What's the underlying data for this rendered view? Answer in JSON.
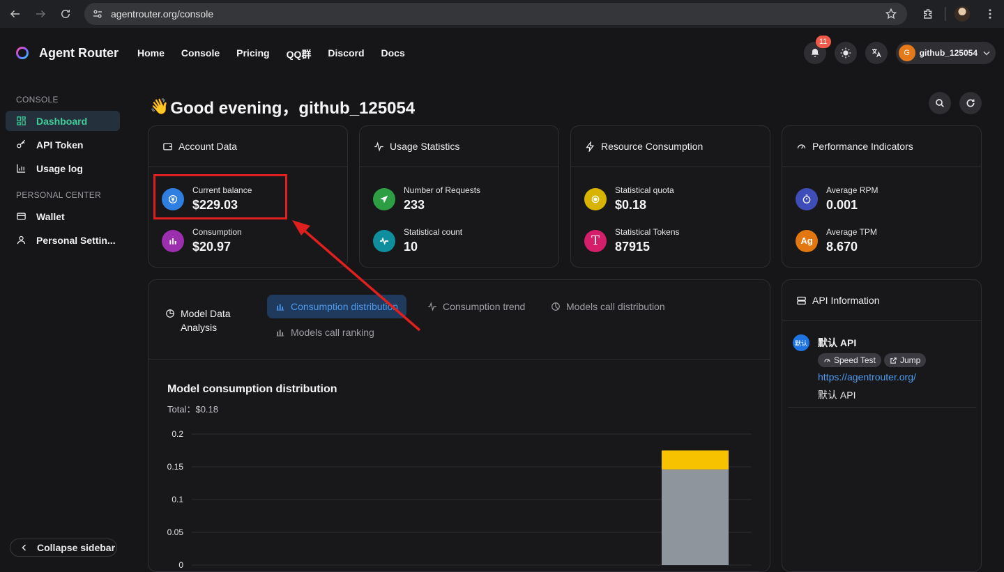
{
  "browser": {
    "url": "agentrouter.org/console"
  },
  "header": {
    "brand": "Agent Router",
    "nav": [
      "Home",
      "Console",
      "Pricing",
      "QQ群",
      "Discord",
      "Docs"
    ],
    "notifications_count": "11",
    "user_initial": "G",
    "username": "github_125054"
  },
  "sidebar": {
    "section_console": "CONSOLE",
    "items_console": [
      {
        "label": "Dashboard",
        "icon": "dashboard-icon",
        "active": true
      },
      {
        "label": "API Token",
        "icon": "key-icon"
      },
      {
        "label": "Usage log",
        "icon": "chart-icon"
      }
    ],
    "section_personal": "PERSONAL CENTER",
    "items_personal": [
      {
        "label": "Wallet",
        "icon": "wallet-icon"
      },
      {
        "label": "Personal Settin...",
        "icon": "user-icon"
      }
    ],
    "collapse_label": "Collapse sidebar"
  },
  "greeting": {
    "emoji": "👋",
    "text": "Good evening，github_125054"
  },
  "cards": {
    "account": {
      "title": "Account Data",
      "stats": [
        {
          "label": "Current balance",
          "value": "$229.03",
          "color": "#2f7fe0"
        },
        {
          "label": "Consumption",
          "value": "$20.97",
          "color": "#9b2fae"
        }
      ]
    },
    "usage": {
      "title": "Usage Statistics",
      "stats": [
        {
          "label": "Number of Requests",
          "value": "233",
          "color": "#2e9e44"
        },
        {
          "label": "Statistical count",
          "value": "10",
          "color": "#0f8f9e"
        }
      ]
    },
    "resource": {
      "title": "Resource Consumption",
      "stats": [
        {
          "label": "Statistical quota",
          "value": "$0.18",
          "color": "#d8b400"
        },
        {
          "label": "Statistical Tokens",
          "value": "87915",
          "color": "#d61f6a",
          "glyph": "T"
        }
      ]
    },
    "performance": {
      "title": "Performance Indicators",
      "stats": [
        {
          "label": "Average RPM",
          "value": "0.001",
          "color": "#3f4db8"
        },
        {
          "label": "Average TPM",
          "value": "8.670",
          "color": "#e2770f",
          "glyph": "Ag"
        }
      ]
    }
  },
  "analysis": {
    "title_line1": "Model Data",
    "title_line2": "Analysis",
    "tabs": [
      {
        "label": "Consumption distribution",
        "active": true
      },
      {
        "label": "Consumption trend"
      },
      {
        "label": "Models call distribution"
      },
      {
        "label": "Models call ranking"
      }
    ],
    "chart_title": "Model consumption distribution",
    "total_label": "Total：",
    "total_value": "$0.18"
  },
  "chart_data": {
    "type": "bar",
    "title": "Model consumption distribution",
    "ylim": [
      0,
      0.2
    ],
    "yticks": [
      "0.2",
      "0.15",
      "0.1",
      "0.05",
      "0"
    ],
    "stacked": true,
    "series": [
      {
        "color": "#8e959c",
        "values": [
          0.146
        ]
      },
      {
        "color": "#f7c300",
        "values": [
          0.029
        ]
      }
    ]
  },
  "api_info": {
    "title": "API Information",
    "badge": "默认",
    "name": "默认 API",
    "speed_test": "Speed Test",
    "jump": "Jump",
    "url": "https://agentrouter.org/",
    "description": "默认 API"
  }
}
